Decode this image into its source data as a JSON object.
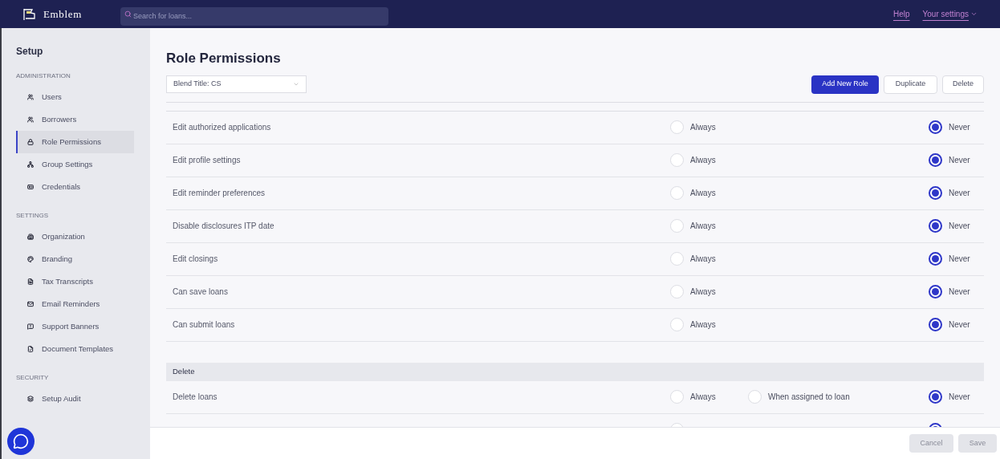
{
  "topbar": {
    "brand": "Emblem",
    "search": {
      "placeholder": "Search for loans..."
    },
    "links": [
      "Help",
      "Your settings"
    ]
  },
  "sidebar": {
    "title": "Setup",
    "groups": [
      {
        "heading": "ADMINISTRATION",
        "items": [
          {
            "label": "Users",
            "selected": false
          },
          {
            "label": "Borrowers",
            "selected": false
          },
          {
            "label": "Role Permissions",
            "selected": true
          },
          {
            "label": "Group Settings",
            "selected": false
          },
          {
            "label": "Credentials",
            "selected": false
          }
        ]
      },
      {
        "heading": "SETTINGS",
        "items": [
          {
            "label": "Organization",
            "selected": false
          },
          {
            "label": "Branding",
            "selected": false
          },
          {
            "label": "Tax Transcripts",
            "selected": false
          },
          {
            "label": "Email Reminders",
            "selected": false
          },
          {
            "label": "Support Banners",
            "selected": false
          },
          {
            "label": "Document Templates",
            "selected": false
          }
        ]
      },
      {
        "heading": "SECURITY",
        "items": [
          {
            "label": "Setup Audit",
            "selected": false
          }
        ]
      }
    ]
  },
  "page": {
    "title": "Role Permissions",
    "role_select": "Blend Title: CS",
    "buttons": [
      {
        "label": "Add New Role",
        "kind": "primary"
      },
      {
        "label": "Duplicate",
        "kind": "secondary"
      },
      {
        "label": "Delete",
        "kind": "secondary"
      }
    ]
  },
  "sections": [
    {
      "rows": [
        {
          "label": "Edit authorized applications",
          "options": [
            {
              "kind": "always",
              "label": "Always",
              "selected": false
            },
            {
              "kind": "never",
              "label": "Never",
              "selected": true
            }
          ]
        },
        {
          "label": "Edit profile settings",
          "options": [
            {
              "kind": "always",
              "label": "Always",
              "selected": false
            },
            {
              "kind": "never",
              "label": "Never",
              "selected": true
            }
          ]
        },
        {
          "label": "Edit reminder preferences",
          "options": [
            {
              "kind": "always",
              "label": "Always",
              "selected": false
            },
            {
              "kind": "never",
              "label": "Never",
              "selected": true
            }
          ]
        },
        {
          "label": "Disable disclosures ITP date",
          "options": [
            {
              "kind": "always",
              "label": "Always",
              "selected": false
            },
            {
              "kind": "never",
              "label": "Never",
              "selected": true
            }
          ]
        },
        {
          "label": "Edit closings",
          "options": [
            {
              "kind": "always",
              "label": "Always",
              "selected": false
            },
            {
              "kind": "never",
              "label": "Never",
              "selected": true
            }
          ]
        },
        {
          "label": "Can save loans",
          "options": [
            {
              "kind": "always",
              "label": "Always",
              "selected": false
            },
            {
              "kind": "never",
              "label": "Never",
              "selected": true
            }
          ]
        },
        {
          "label": "Can submit loans",
          "options": [
            {
              "kind": "always",
              "label": "Always",
              "selected": false
            },
            {
              "kind": "never",
              "label": "Never",
              "selected": true
            }
          ]
        }
      ]
    },
    {
      "title": "Delete",
      "rows": [
        {
          "label": "Delete loans",
          "options": [
            {
              "kind": "always",
              "label": "Always",
              "selected": false
            },
            {
              "kind": "assigned",
              "label": "When assigned to loan",
              "selected": false
            },
            {
              "kind": "never",
              "label": "Never",
              "selected": true
            }
          ]
        },
        {
          "options": [
            {
              "kind": "always",
              "selected": false
            },
            {
              "kind": "never",
              "selected": true
            }
          ]
        }
      ]
    }
  ],
  "footer": {
    "buttons": [
      "Cancel",
      "Save"
    ]
  }
}
